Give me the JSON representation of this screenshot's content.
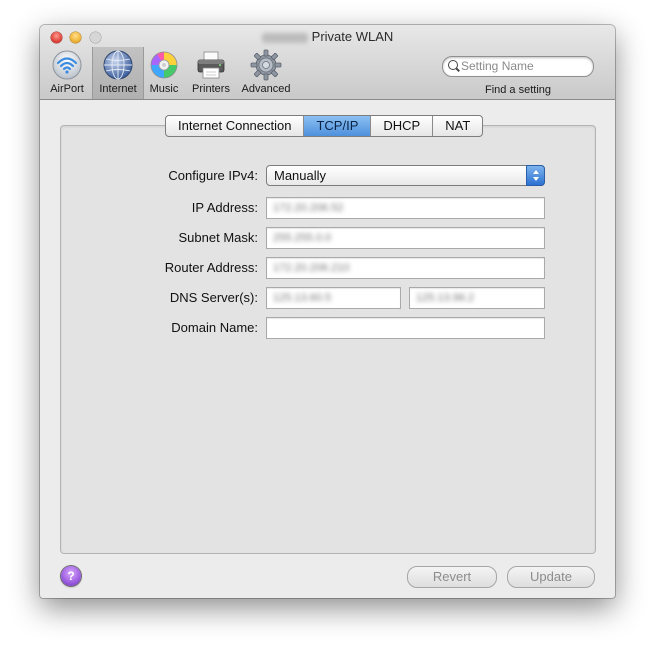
{
  "window": {
    "title": "Private WLAN"
  },
  "toolbar": {
    "items": [
      {
        "label": "AirPort",
        "icon": "airport-wifi-icon"
      },
      {
        "label": "Internet",
        "icon": "internet-globe-icon",
        "selected": true
      },
      {
        "label": "Music",
        "icon": "music-disc-icon"
      },
      {
        "label": "Printers",
        "icon": "printer-icon"
      },
      {
        "label": "Advanced",
        "icon": "gear-icon"
      }
    ],
    "search_placeholder": "Setting Name",
    "find_label": "Find a setting"
  },
  "tabs": [
    {
      "label": "Internet Connection"
    },
    {
      "label": "TCP/IP",
      "active": true
    },
    {
      "label": "DHCP"
    },
    {
      "label": "NAT"
    }
  ],
  "form": {
    "configure_label": "Configure IPv4:",
    "configure_value": "Manually",
    "ip_label": "IP Address:",
    "ip_value": "172.20.206.52",
    "subnet_label": "Subnet Mask:",
    "subnet_value": "255.255.0.0",
    "router_label": "Router Address:",
    "router_value": "172.20.206.210",
    "dns_label": "DNS Server(s):",
    "dns_value_1": "125.13.60.5",
    "dns_value_2": "125.13.96.2",
    "domain_label": "Domain Name:",
    "domain_value": ""
  },
  "footer": {
    "help_label": "?",
    "revert_label": "Revert",
    "update_label": "Update"
  },
  "colors": {
    "accent": "#4e90dc",
    "help": "#9b5cdf"
  }
}
